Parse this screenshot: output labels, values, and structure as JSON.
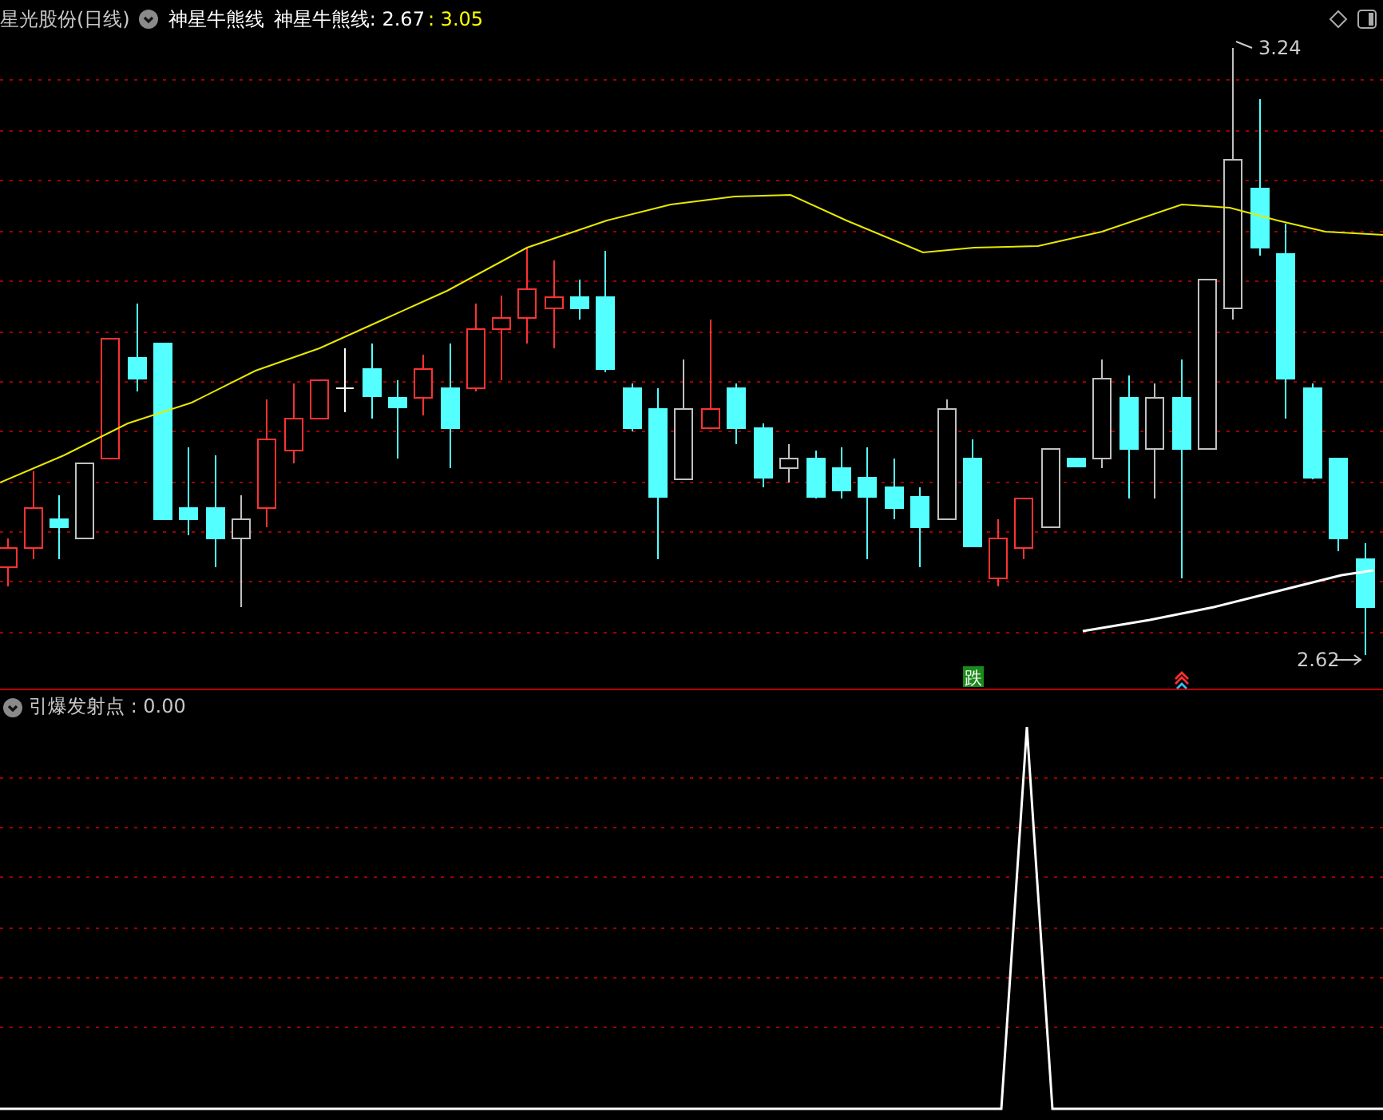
{
  "header": {
    "stock": "星光股份(日线)",
    "indicator": "神星牛熊线",
    "reading": "神星牛熊线: 2.67",
    "reading_2": ": 3.05"
  },
  "main_chart": {
    "high_label": "3.24",
    "low_label": "2.62",
    "signal": "跌"
  },
  "sub_panel": {
    "title": "引爆发射点 : 0.00"
  }
}
